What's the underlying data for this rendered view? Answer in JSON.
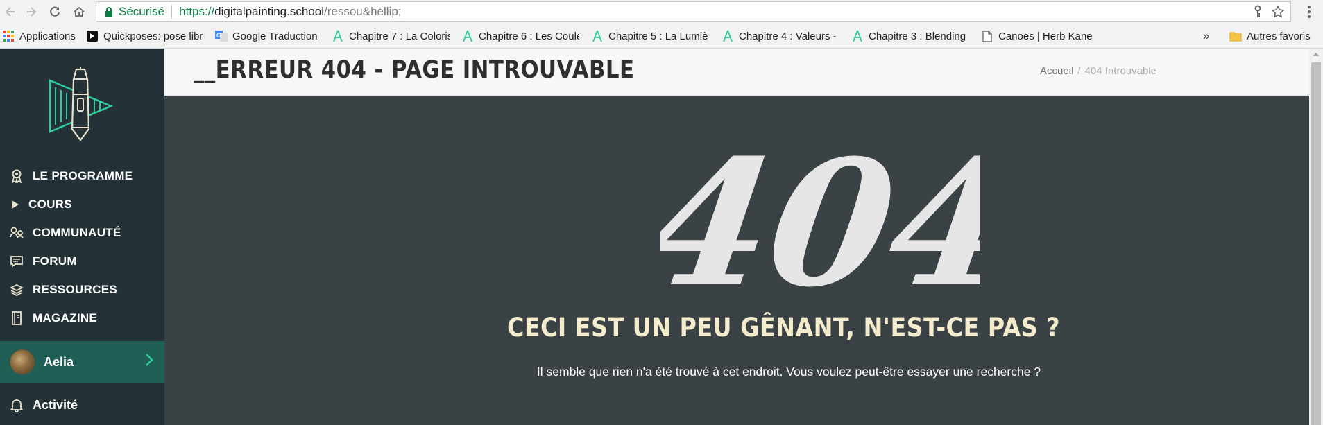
{
  "browser": {
    "secure_label": "Sécurisé",
    "url_scheme": "https://",
    "url_host": "digitalpainting.school",
    "url_path": "/ressou&hellip;",
    "bookmarks": [
      {
        "label": "Applications",
        "icon": "apps-grid-icon"
      },
      {
        "label": "Quickposes: pose libr",
        "icon": "quickposes-icon"
      },
      {
        "label": "Google Traduction",
        "icon": "google-translate-icon"
      },
      {
        "label": "Chapitre 7 : La Coloris",
        "icon": "course-logo-icon"
      },
      {
        "label": "Chapitre 6 : Les Coule",
        "icon": "course-logo-icon"
      },
      {
        "label": "Chapitre 5 : La Lumiè",
        "icon": "course-logo-icon"
      },
      {
        "label": "Chapitre 4 : Valeurs -",
        "icon": "course-logo-icon"
      },
      {
        "label": "Chapitre 3 : Blending",
        "icon": "course-logo-icon"
      },
      {
        "label": "Canoes | Herb Kane",
        "icon": "page-icon"
      }
    ],
    "overflow_label": "»",
    "other_bookmarks_label": "Autres favoris"
  },
  "sidebar": {
    "items": [
      {
        "label": "LE PROGRAMME",
        "icon": "badge-icon"
      },
      {
        "label": "COURS",
        "icon": "play-icon"
      },
      {
        "label": "COMMUNAUTÉ",
        "icon": "community-icon"
      },
      {
        "label": "FORUM",
        "icon": "chat-icon"
      },
      {
        "label": "RESSOURCES",
        "icon": "layers-icon"
      },
      {
        "label": "MAGAZINE",
        "icon": "book-icon"
      }
    ],
    "user_name": "Aelia",
    "activity_label": "Activité"
  },
  "header": {
    "title": "__ERREUR 404 - PAGE INTROUVABLE",
    "breadcrumb_home": "Accueil",
    "breadcrumb_sep": "/",
    "breadcrumb_current": "404 Introuvable"
  },
  "main": {
    "big_code": "404",
    "heading": "CECI EST UN PEU GÊNANT, N'EST-CE PAS ?",
    "subtext": "Il semble que rien n'a été trouvé à cet endroit. Vous voulez peut-être essayer une recherche ?"
  },
  "colors": {
    "sidebar_bg": "#243136",
    "accent_teal": "#2ecc9a",
    "user_row_bg": "#1f5f56",
    "main_bg": "#3a4245",
    "heading_cream": "#f4eccc"
  }
}
